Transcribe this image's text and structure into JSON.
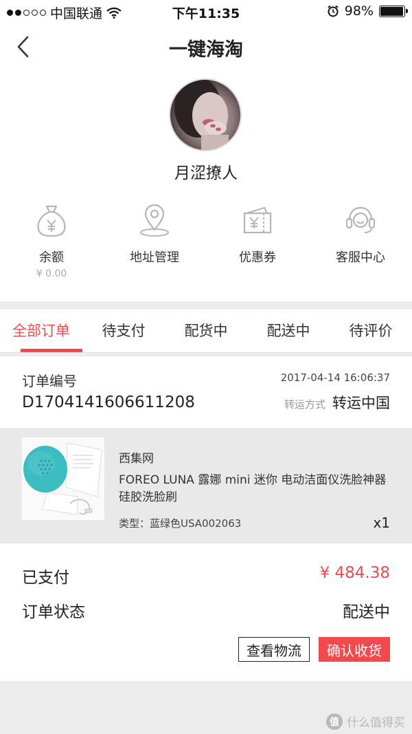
{
  "status_bar": {
    "carrier": "中国联通",
    "time": "下午11:35",
    "battery": "98%",
    "battery_level": 0.98
  },
  "nav": {
    "title": "一键海淘"
  },
  "profile": {
    "username": "月涩撩人"
  },
  "features": [
    {
      "label": "余额",
      "sub": "¥ 0.00",
      "icon": "money-bag-icon"
    },
    {
      "label": "地址管理",
      "icon": "location-pin-icon"
    },
    {
      "label": "优惠券",
      "icon": "coupon-icon"
    },
    {
      "label": "客服中心",
      "icon": "headset-icon"
    }
  ],
  "tabs": [
    {
      "label": "全部订单",
      "active": true
    },
    {
      "label": "待支付"
    },
    {
      "label": "配货中"
    },
    {
      "label": "配送中"
    },
    {
      "label": "待评价"
    }
  ],
  "order": {
    "number_label": "订单编号",
    "number": "D1704141606611208",
    "datetime": "2017-04-14 16:06:37",
    "shipping_label": "转运方式",
    "shipping_value": "转运中国"
  },
  "product": {
    "shop": "西集网",
    "name": "FOREO LUNA 露娜 mini 迷你 电动洁面仪洗脸神器 硅胶洗脸刷",
    "type_label": "类型：",
    "type_value": "蓝绿色USA002063",
    "quantity": "x1"
  },
  "summary": {
    "paid_label": "已支付",
    "paid_value": "¥ 484.38",
    "status_label": "订单状态",
    "status_value": "配送中"
  },
  "buttons": {
    "logistics": "查看物流",
    "confirm": "确认收货"
  },
  "watermark": {
    "badge": "值",
    "text": "什么值得买"
  },
  "colors": {
    "accent": "#f2494f",
    "product_teal": "#3bbcc0"
  }
}
